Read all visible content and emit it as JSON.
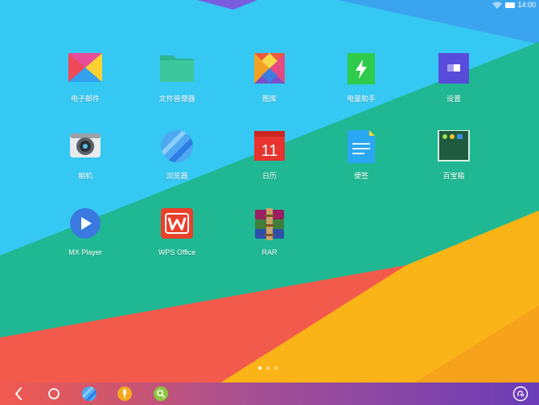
{
  "status_bar": {
    "time": "14:00"
  },
  "home_screen": {
    "page_count": 3,
    "active_page": 1,
    "apps": [
      {
        "label": "电子邮件",
        "icon": "email-app-icon"
      },
      {
        "label": "文件管理器",
        "icon": "folder-app-icon"
      },
      {
        "label": "图库",
        "icon": "gallery-app-icon"
      },
      {
        "label": "电量助手",
        "icon": "battery-assistant-app-icon"
      },
      {
        "label": "设置",
        "icon": "settings-app-icon"
      },
      {
        "label": "相机",
        "icon": "camera-app-icon"
      },
      {
        "label": "浏览器",
        "icon": "browser-app-icon"
      },
      {
        "label": "日历",
        "icon": "calendar-app-icon",
        "date": "11"
      },
      {
        "label": "便签",
        "icon": "notes-app-icon"
      },
      {
        "label": "百宝箱",
        "icon": "toolbox-app-icon"
      },
      {
        "label": "MX Player",
        "icon": "mx-player-app-icon"
      },
      {
        "label": "WPS Office",
        "icon": "wps-office-app-icon"
      },
      {
        "label": "RAR",
        "icon": "rar-app-icon"
      }
    ]
  },
  "nav_bar": {
    "buttons": [
      "back-icon",
      "home-icon",
      "browser-shortcut-icon",
      "voice-icon",
      "search-icon",
      "assistive-icon"
    ]
  },
  "colors": {
    "wallpaper_sky": "#35c8f2",
    "wallpaper_teal": "#1fb892",
    "wallpaper_red": "#f25a4c",
    "wallpaper_yellow": "#fbb418",
    "nav_gradient_start": "#f15a4f",
    "nav_gradient_end": "#6a3db8"
  }
}
